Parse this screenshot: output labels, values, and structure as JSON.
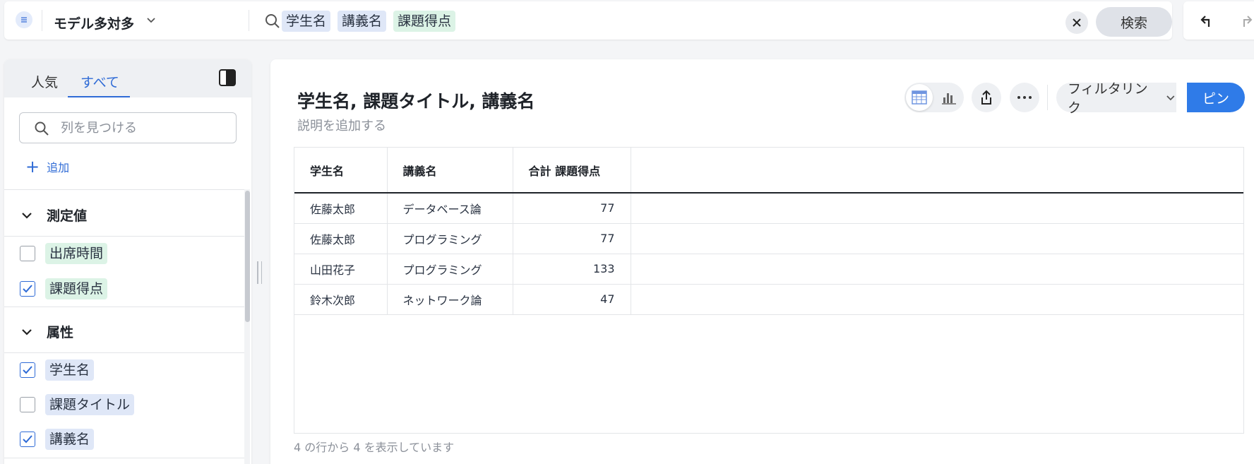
{
  "header": {
    "menu_icon": "hamburger-icon",
    "model_name": "モデル多対多",
    "search_chips": [
      {
        "label": "学生名",
        "color": "#dfe7f7"
      },
      {
        "label": "講義名",
        "color": "#dfe7f7"
      },
      {
        "label": "課題得点",
        "color": "#dcf3e6"
      }
    ],
    "clear_label": "✕",
    "search_button": "検索"
  },
  "sidebar": {
    "tabs": [
      {
        "label": "人気",
        "active": false
      },
      {
        "label": "すべて",
        "active": true
      }
    ],
    "find_placeholder": "列を見つける",
    "add_label": "追加",
    "sections": [
      {
        "title": "測定値",
        "fields": [
          {
            "label": "出席時間",
            "checked": false,
            "color": "#dcf3e6"
          },
          {
            "label": "課題得点",
            "checked": true,
            "color": "#dcf3e6"
          }
        ]
      },
      {
        "title": "属性",
        "fields": [
          {
            "label": "学生名",
            "checked": true,
            "color": "#dfe7f7"
          },
          {
            "label": "課題タイトル",
            "checked": false,
            "color": "#dfe7f7"
          },
          {
            "label": "講義名",
            "checked": true,
            "color": "#dfe7f7"
          }
        ]
      }
    ]
  },
  "main": {
    "title": "学生名, 課題タイトル, 講義名",
    "description": "説明を追加する",
    "filter_label": "フィルタリンク",
    "pin_label": "ピン",
    "table": {
      "columns": [
        "学生名",
        "講義名",
        "合計 課題得点"
      ],
      "rows": [
        [
          "佐藤太郎",
          "データベース論",
          "77"
        ],
        [
          "佐藤太郎",
          "プログラミング",
          "77"
        ],
        [
          "山田花子",
          "プログラミング",
          "133"
        ],
        [
          "鈴木次郎",
          "ネットワーク論",
          "47"
        ]
      ]
    },
    "footer": "4 の行から 4 を表示しています"
  },
  "colors": {
    "accent": "#2f6bd6",
    "pin_button": "#2f7be8"
  }
}
